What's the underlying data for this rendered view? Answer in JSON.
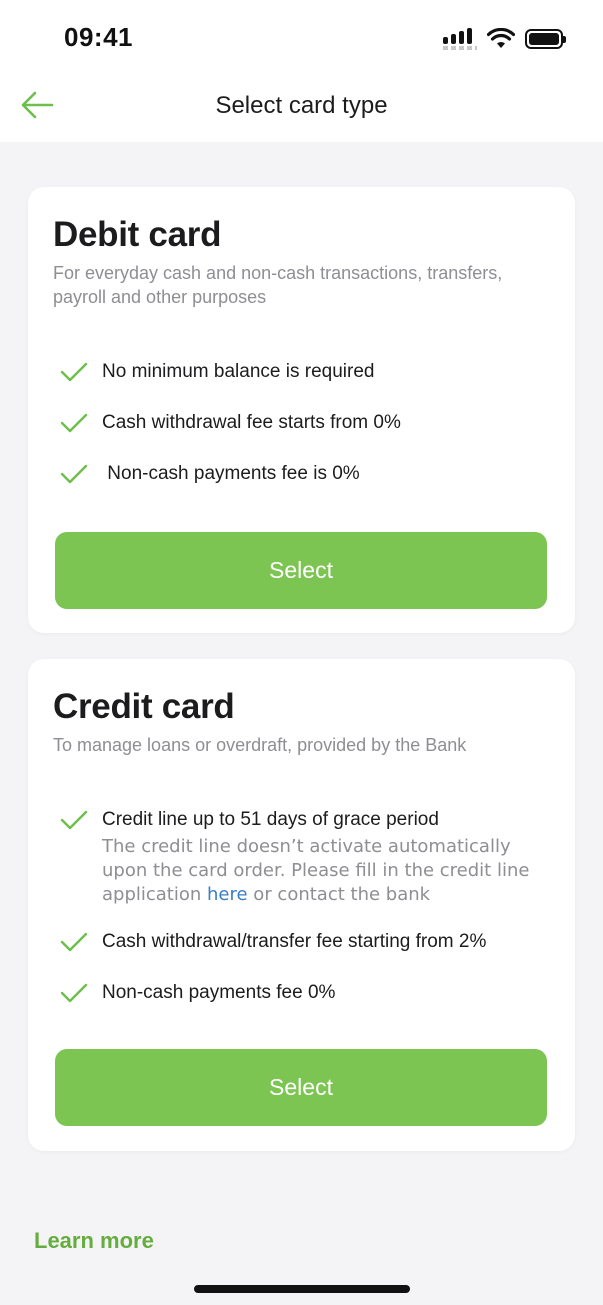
{
  "status_bar": {
    "time": "09:41"
  },
  "header": {
    "title": "Select card type",
    "back_icon": "arrow-left-icon"
  },
  "cards": [
    {
      "title": "Debit card",
      "description": "For everyday cash and non-cash transactions, transfers, payroll and other purposes",
      "features": [
        {
          "text": "No minimum balance is required"
        },
        {
          "text": "Cash withdrawal fee starts from 0%"
        },
        {
          "text": " Non-cash payments fee is 0%"
        }
      ],
      "button_label": "Select"
    },
    {
      "title": "Credit card",
      "description": "To manage loans or overdraft, provided by the Bank",
      "features": [
        {
          "text": "Credit line up to 51 days of grace period",
          "note_before": "The credit line doesn’t activate automatically upon the card order. Please fill in the credit line application ",
          "note_link": "here",
          "note_after": " or contact the bank"
        },
        {
          "text": "Cash withdrawal/transfer fee starting from 2%"
        },
        {
          "text": "Non-cash payments fee 0%"
        }
      ],
      "button_label": "Select"
    }
  ],
  "footer": {
    "learn_more": "Learn more"
  },
  "colors": {
    "accent": "#7cc552",
    "link_green": "#65ad3f",
    "check_green": "#6cbf4a",
    "link_blue": "#3a7ec4",
    "background": "#f4f4f6"
  },
  "icons": {
    "check": "checkmark-icon",
    "signal": "cellular-signal-icon",
    "wifi": "wifi-icon",
    "battery": "battery-icon"
  }
}
